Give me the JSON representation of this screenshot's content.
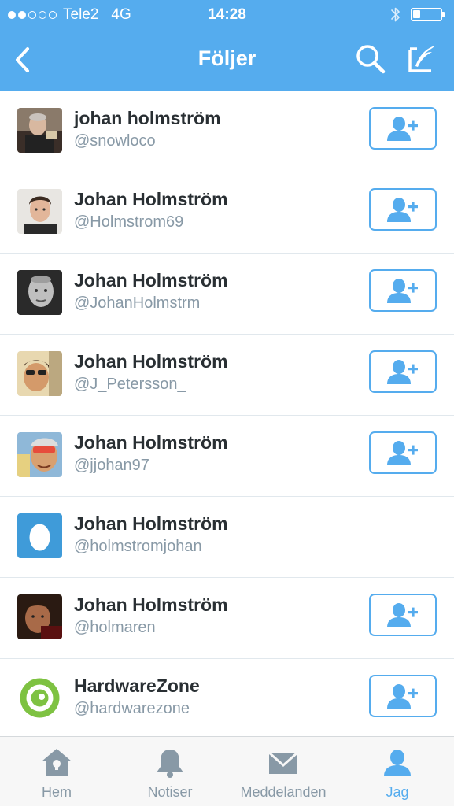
{
  "status_bar": {
    "carrier": "Tele2",
    "network": "4G",
    "time": "14:28",
    "signal_bars_filled": 2,
    "signal_bars_total": 5,
    "battery_level": 0.25
  },
  "nav": {
    "title": "Följer",
    "back_icon": "chevron-left-icon",
    "search_icon": "search-icon",
    "compose_icon": "compose-tweet-icon"
  },
  "colors": {
    "accent": "#55acee",
    "name_text": "#292f33",
    "handle_text": "#8899a6",
    "divider": "#e1e8ed"
  },
  "users": [
    {
      "name": "johan holmström",
      "handle": "@snowloco",
      "avatar": "photo",
      "follow_button": true
    },
    {
      "name": "Johan Holmström",
      "handle": "@Holmstrom69",
      "avatar": "photo",
      "follow_button": true
    },
    {
      "name": "Johan Holmström",
      "handle": "@JohanHolmstrm",
      "avatar": "photo",
      "follow_button": true
    },
    {
      "name": "Johan Holmström",
      "handle": "@J_Petersson_",
      "avatar": "photo",
      "follow_button": true
    },
    {
      "name": "Johan Holmström",
      "handle": "@jjohan97",
      "avatar": "photo",
      "follow_button": true
    },
    {
      "name": "Johan Holmström",
      "handle": "@holmstromjohan",
      "avatar": "default-egg",
      "follow_button": false
    },
    {
      "name": "Johan Holmström",
      "handle": "@holmaren",
      "avatar": "photo",
      "follow_button": true
    },
    {
      "name": "HardwareZone",
      "handle": "@hardwarezone",
      "avatar": "logo",
      "follow_button": true
    }
  ],
  "tabbar": {
    "tabs": [
      {
        "label": "Hem",
        "icon": "home-icon",
        "active": false
      },
      {
        "label": "Notiser",
        "icon": "bell-icon",
        "active": false
      },
      {
        "label": "Meddelanden",
        "icon": "envelope-icon",
        "active": false
      },
      {
        "label": "Jag",
        "icon": "person-icon",
        "active": true
      }
    ]
  }
}
